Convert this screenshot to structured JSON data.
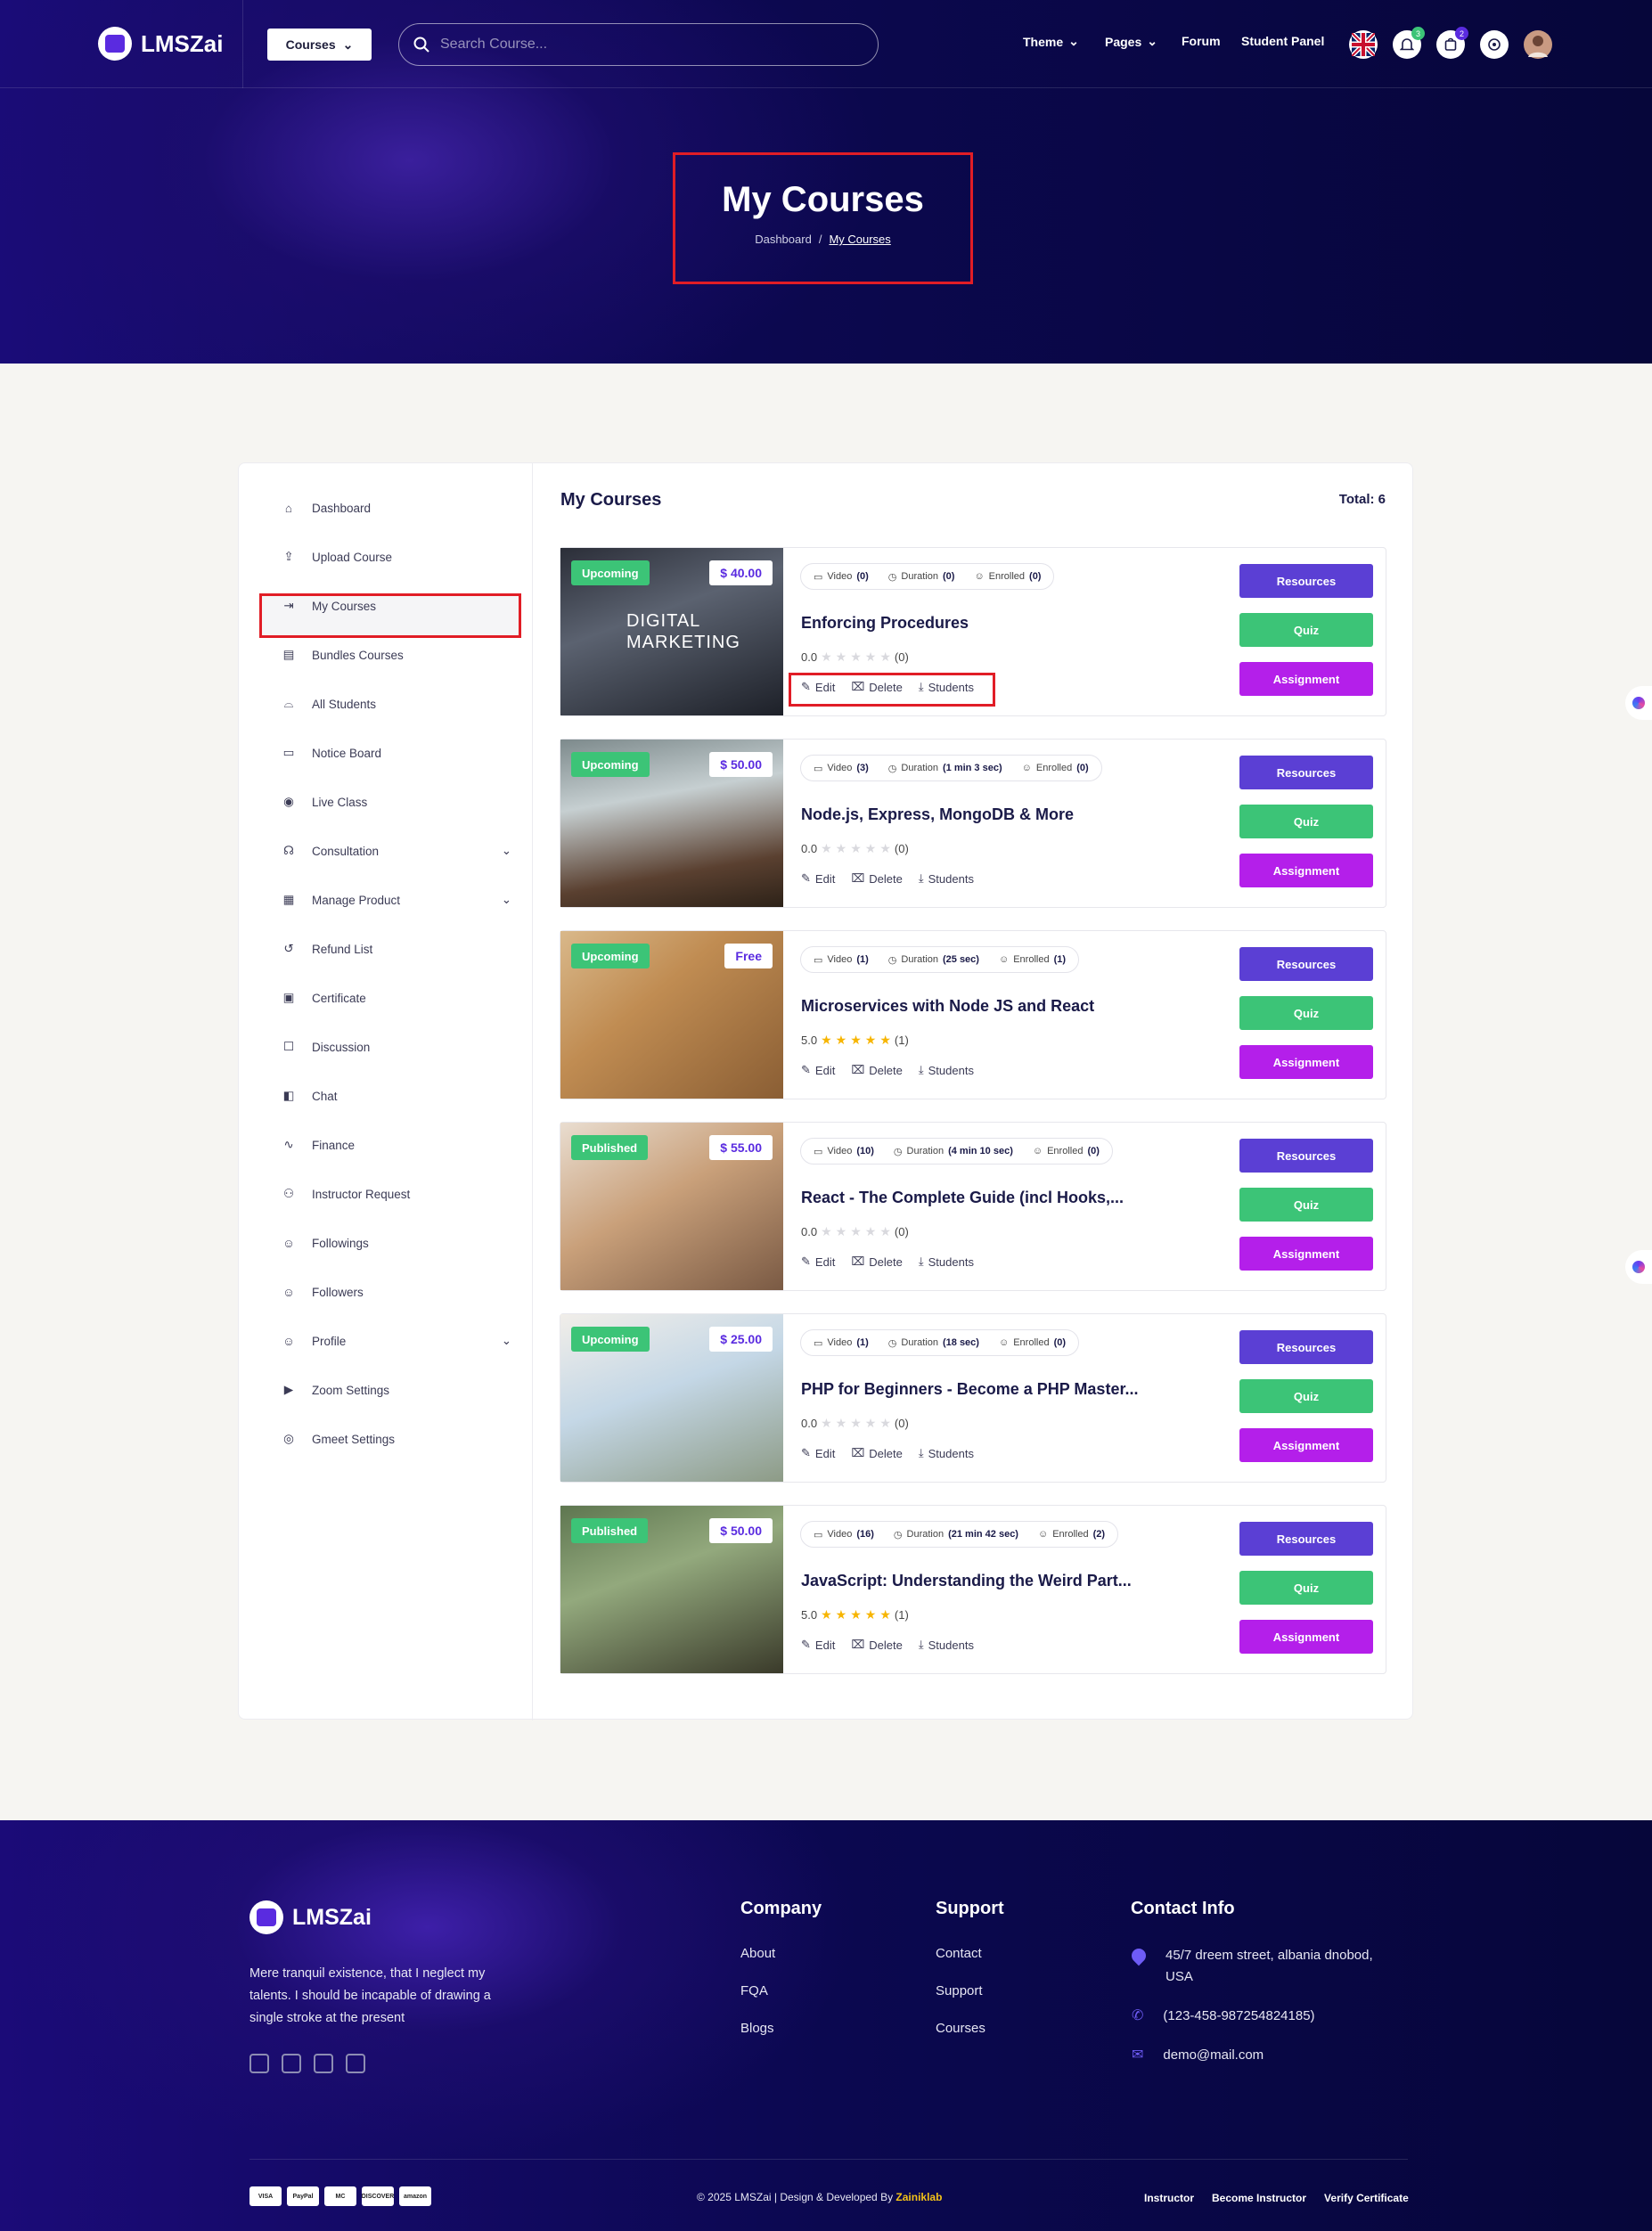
{
  "header": {
    "logo": "LMSZai",
    "courses_button": "Courses",
    "search_placeholder": "Search Course...",
    "nav": [
      "Theme",
      "Pages",
      "Forum",
      "Student Panel"
    ],
    "notification_count": "3",
    "cart_count": "2"
  },
  "hero": {
    "title": "My Courses",
    "breadcrumb_home": "Dashboard",
    "breadcrumb_current": "My Courses"
  },
  "sidebar": {
    "items": [
      {
        "label": "Dashboard",
        "icon": "home-icon"
      },
      {
        "label": "Upload Course",
        "icon": "upload-icon"
      },
      {
        "label": "My Courses",
        "icon": "enter-icon",
        "active": true
      },
      {
        "label": "Bundles Courses",
        "icon": "bundle-icon"
      },
      {
        "label": "All Students",
        "icon": "graduation-cap-icon"
      },
      {
        "label": "Notice Board",
        "icon": "board-icon"
      },
      {
        "label": "Live Class",
        "icon": "broadcast-icon"
      },
      {
        "label": "Consultation",
        "icon": "headset-icon",
        "expandable": true
      },
      {
        "label": "Manage Product",
        "icon": "box-icon",
        "expandable": true
      },
      {
        "label": "Refund List",
        "icon": "refund-icon"
      },
      {
        "label": "Certificate",
        "icon": "certificate-icon"
      },
      {
        "label": "Discussion",
        "icon": "discussion-icon"
      },
      {
        "label": "Chat",
        "icon": "chat-icon"
      },
      {
        "label": "Finance",
        "icon": "pulse-icon"
      },
      {
        "label": "Instructor Request",
        "icon": "request-icon"
      },
      {
        "label": "Followings",
        "icon": "user-add-icon"
      },
      {
        "label": "Followers",
        "icon": "user-icon"
      },
      {
        "label": "Profile",
        "icon": "profile-icon",
        "expandable": true
      },
      {
        "label": "Zoom Settings",
        "icon": "video-icon"
      },
      {
        "label": "Gmeet Settings",
        "icon": "meet-icon"
      }
    ]
  },
  "content": {
    "title": "My Courses",
    "total": "Total: 6",
    "labels": {
      "video": "Video",
      "duration": "Duration",
      "enrolled": "Enrolled",
      "edit": "Edit",
      "delete": "Delete",
      "students": "Students",
      "resources": "Resources",
      "quiz": "Quiz",
      "assignment": "Assignment"
    },
    "courses": [
      {
        "status": "Upcoming",
        "price": "$ 40.00",
        "video": "(0)",
        "duration": "(0)",
        "enrolled": "(0)",
        "title": "Enforcing Procedures",
        "rating": "0.0",
        "stars": 0,
        "reviews": "(0)"
      },
      {
        "status": "Upcoming",
        "price": "$ 50.00",
        "video": "(3)",
        "duration": "(1 min 3 sec)",
        "enrolled": "(0)",
        "title": "Node.js, Express, MongoDB & More",
        "rating": "0.0",
        "stars": 0,
        "reviews": "(0)"
      },
      {
        "status": "Upcoming",
        "price": "Free",
        "video": "(1)",
        "duration": "(25 sec)",
        "enrolled": "(1)",
        "title": "Microservices with Node JS and React",
        "rating": "5.0",
        "stars": 5,
        "reviews": "(1)"
      },
      {
        "status": "Published",
        "price": "$ 55.00",
        "video": "(10)",
        "duration": "(4 min 10 sec)",
        "enrolled": "(0)",
        "title": "React - The Complete Guide (incl Hooks,...",
        "rating": "0.0",
        "stars": 0,
        "reviews": "(0)"
      },
      {
        "status": "Upcoming",
        "price": "$ 25.00",
        "video": "(1)",
        "duration": "(18 sec)",
        "enrolled": "(0)",
        "title": "PHP for Beginners - Become a PHP Master...",
        "rating": "0.0",
        "stars": 0,
        "reviews": "(0)"
      },
      {
        "status": "Published",
        "price": "$ 50.00",
        "video": "(16)",
        "duration": "(21 min 42 sec)",
        "enrolled": "(2)",
        "title": "JavaScript: Understanding the Weird Part...",
        "rating": "5.0",
        "stars": 5,
        "reviews": "(1)"
      }
    ],
    "thumb1_text": "DIGITAL MARKETING"
  },
  "footer": {
    "logo": "LMSZai",
    "about": "Mere tranquil existence, that I neglect my talents. I should be incapable of drawing a single stroke at the present",
    "company_title": "Company",
    "company_links": [
      "About",
      "FQA",
      "Blogs"
    ],
    "support_title": "Support",
    "support_links": [
      "Contact",
      "Support",
      "Courses"
    ],
    "contact_title": "Contact Info",
    "address": "45/7 dreem street, albania dnobod, USA",
    "phone": "(123-458-987254824185)",
    "email": "demo@mail.com",
    "payments": [
      "VISA",
      "PayPal",
      "MC",
      "DISCOVER",
      "amazon"
    ],
    "copyright": "© 2025 LMSZai | Design & Developed By",
    "brand": "Zainiklab",
    "bottom_links": [
      "Instructor",
      "Become Instructor",
      "Verify Certificate"
    ]
  },
  "colors": {
    "accent": "#5a2be0",
    "upcoming": "#3cc477",
    "resources": "#5b3fd4",
    "quiz": "#3cc477",
    "assignment": "#b41fea",
    "highlight": "#e11d26"
  }
}
